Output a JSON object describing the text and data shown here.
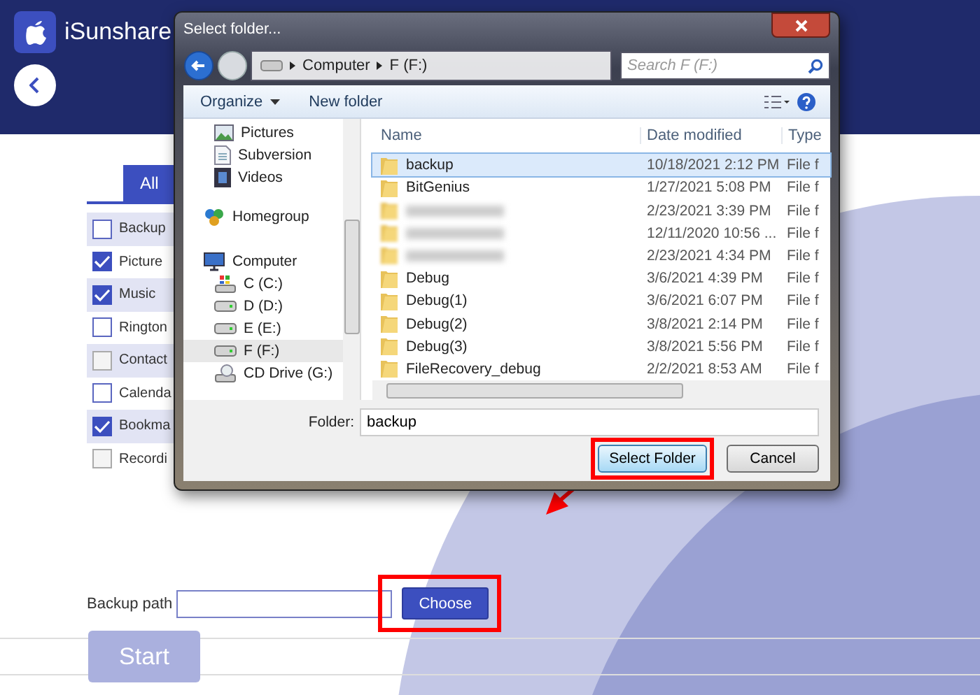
{
  "app": {
    "title": "iSunshare",
    "tab": {
      "label": "All",
      "selected": true
    },
    "options": [
      {
        "label": "Backup",
        "checked": false,
        "disabled": false
      },
      {
        "label": "Picture",
        "checked": true,
        "disabled": false
      },
      {
        "label": "Music",
        "checked": true,
        "disabled": false
      },
      {
        "label": "Rington",
        "checked": false,
        "disabled": false
      },
      {
        "label": "Contact",
        "checked": false,
        "disabled": true
      },
      {
        "label": "Calenda",
        "checked": false,
        "disabled": false
      },
      {
        "label": "Bookma",
        "checked": true,
        "disabled": false
      },
      {
        "label": "Recordi",
        "checked": false,
        "disabled": true
      }
    ],
    "backup_path": {
      "label": "Backup path"
    },
    "choose_button": {
      "label": "Choose",
      "highlighted": true
    },
    "start_button": {
      "label": "Start",
      "disabled": true
    }
  },
  "dialog": {
    "title": "Select folder...",
    "breadcrumb": [
      "Computer",
      "F (F:)"
    ],
    "search": {
      "placeholder": "Search F (F:)"
    },
    "toolbar": [
      "Organize",
      "New folder"
    ],
    "nav": [
      {
        "label": "Pictures",
        "kind": "pictures",
        "selected": false
      },
      {
        "label": "Subversion",
        "kind": "document",
        "selected": false
      },
      {
        "label": "Videos",
        "kind": "videos",
        "selected": false
      },
      {
        "label": "Homegroup",
        "kind": "homegroup",
        "selected": false
      },
      {
        "label": "Computer",
        "kind": "computer",
        "selected": false
      },
      {
        "label": "C (C:)",
        "kind": "system-drive",
        "selected": false
      },
      {
        "label": "D (D:)",
        "kind": "drive",
        "selected": false
      },
      {
        "label": "E (E:)",
        "kind": "drive",
        "selected": false
      },
      {
        "label": "F (F:)",
        "kind": "drive",
        "selected": true
      },
      {
        "label": "CD Drive (G:)",
        "kind": "cd",
        "selected": false
      }
    ],
    "columns": [
      "Name",
      "Date modified",
      "Type"
    ],
    "files": [
      {
        "name": "backup",
        "date": "10/18/2021 2:12 PM",
        "type": "File f",
        "selected": true,
        "blurred": false
      },
      {
        "name": "BitGenius",
        "date": "1/27/2021 5:08 PM",
        "type": "File f",
        "selected": false,
        "blurred": false
      },
      {
        "date": "2/23/2021 3:39 PM",
        "type": "File f",
        "selected": false,
        "blurred": true
      },
      {
        "date": "12/11/2020 10:56 ...",
        "type": "File f",
        "selected": false,
        "blurred": true
      },
      {
        "date": "2/23/2021 4:34 PM",
        "type": "File f",
        "selected": false,
        "blurred": true
      },
      {
        "name": "Debug",
        "date": "3/6/2021 4:39 PM",
        "type": "File f",
        "selected": false,
        "blurred": false
      },
      {
        "name": "Debug(1)",
        "date": "3/6/2021 6:07 PM",
        "type": "File f",
        "selected": false,
        "blurred": false
      },
      {
        "name": "Debug(2)",
        "date": "3/8/2021 2:14 PM",
        "type": "File f",
        "selected": false,
        "blurred": false
      },
      {
        "name": "Debug(3)",
        "date": "3/8/2021 5:56 PM",
        "type": "File f",
        "selected": false,
        "blurred": false
      },
      {
        "name": "FileRecovery_debug",
        "date": "2/2/2021 8:53 AM",
        "type": "File f",
        "selected": false,
        "blurred": false
      }
    ],
    "folder": {
      "label": "Folder:",
      "value": "backup"
    },
    "buttons": [
      {
        "label": "Select Folder",
        "highlighted": true
      },
      {
        "label": "Cancel",
        "highlighted": false
      }
    ]
  }
}
